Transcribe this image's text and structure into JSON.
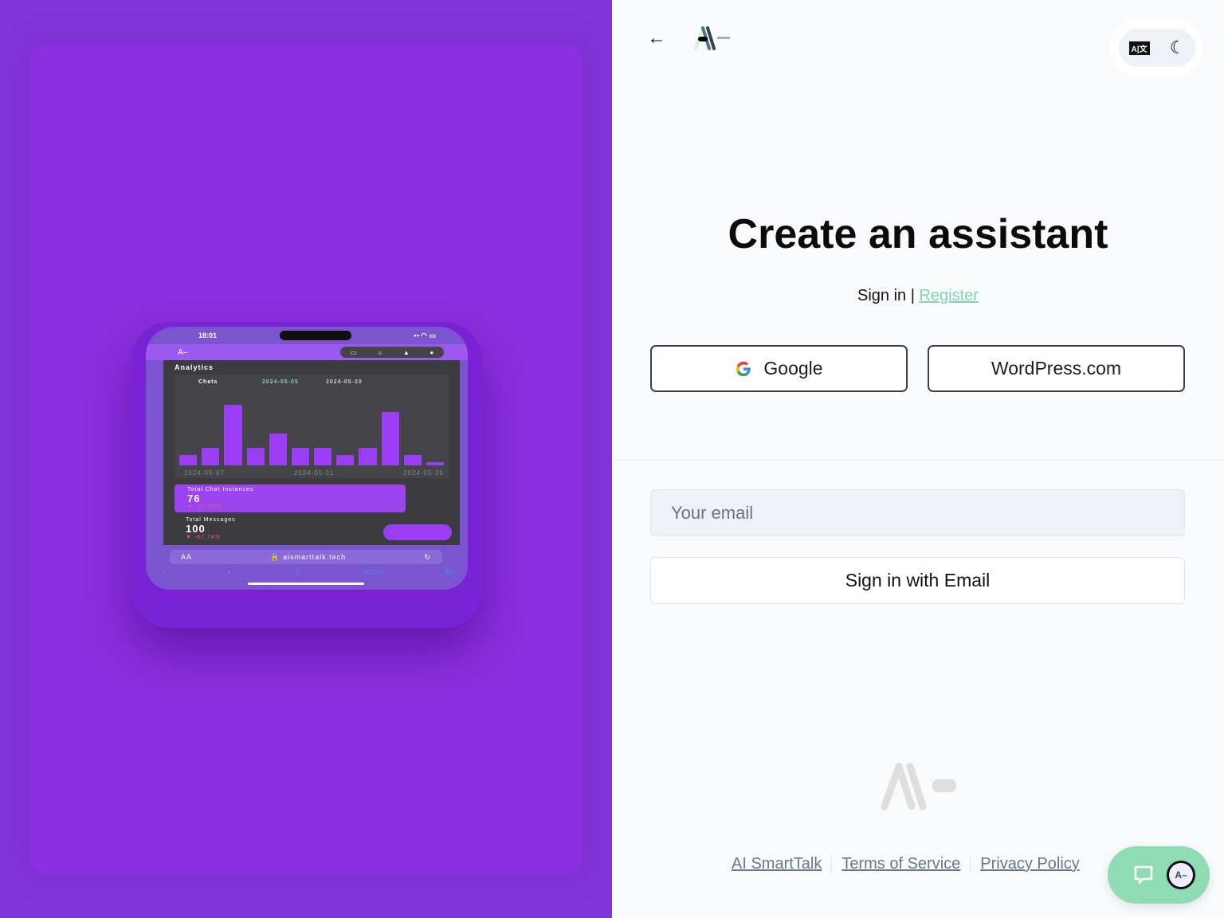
{
  "hero_phone": {
    "time": "18:01",
    "page_heading": "Analytics",
    "chart_title": "Chats",
    "date_from": "2024-05-05",
    "date_to": "2024-05-20",
    "bar_levels": [
      0.15,
      0.25,
      0.85,
      0.25,
      0.45,
      0.25,
      0.25,
      0.15,
      0.25,
      0.75,
      0.15,
      0.05
    ],
    "x_ticks": [
      "2024-05-07",
      "2024-05-11",
      "2024-05-20"
    ],
    "total_chat_label": "Total Chat Instances",
    "total_chat_value": "76",
    "total_chat_change": "-67.93%",
    "total_messages_label": "Total Messages",
    "total_messages_value": "100",
    "total_messages_change": "-67.74%",
    "url_aa": "AA",
    "url": "aismarttalk.tech"
  },
  "header": {
    "back_icon": "arrow-left-icon",
    "translate_icon": "translate-icon",
    "theme_icon": "moon-icon"
  },
  "main": {
    "title": "Create an assistant",
    "sign_in": "Sign in |",
    "register": "Register",
    "google_label": "Google",
    "wordpress_label": "WordPress.com",
    "email_placeholder": "Your email",
    "email_button": "Sign in with Email"
  },
  "footer": {
    "links": [
      "AI SmartTalk",
      "Terms of Service",
      "Privacy Policy"
    ]
  },
  "colors": {
    "left_bg": "#8034d9",
    "accent_green": "#8fdbb4",
    "register_link": "#7fd3b3"
  }
}
